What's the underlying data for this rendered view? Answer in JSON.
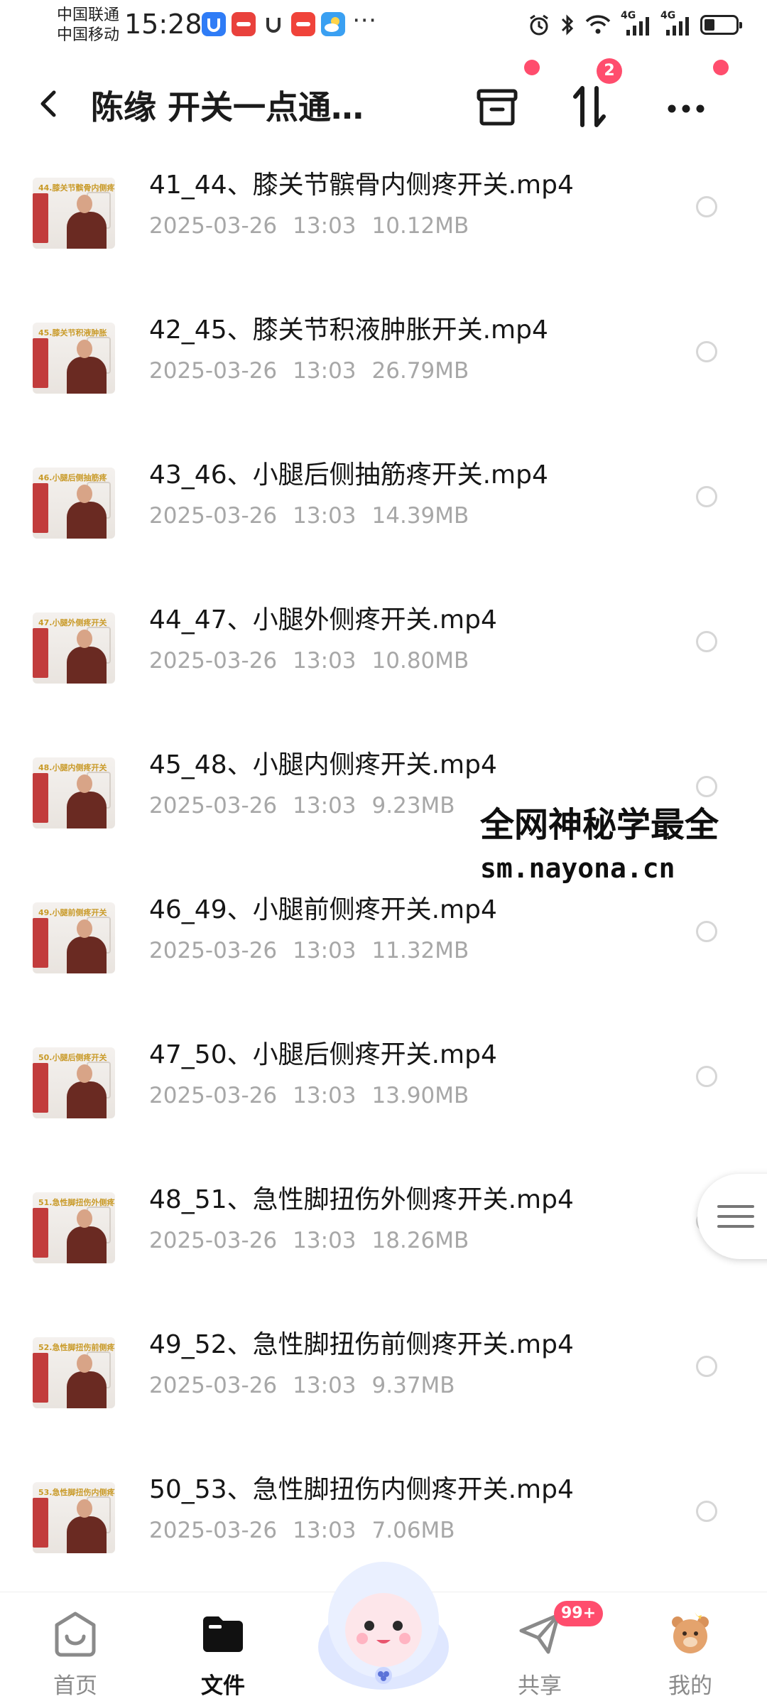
{
  "status_bar": {
    "carrier_1": "中国联通",
    "carrier_2": "中国移动",
    "time": "15:28",
    "signal_label_1": "4G",
    "signal_label_2": "4G"
  },
  "app_bar": {
    "title": "陈缘 开关一点通…",
    "sort_badge": "2"
  },
  "files": [
    {
      "name": "41_44、膝关节髌骨内侧疼开关.mp4",
      "date": "2025-03-26",
      "time": "13:03",
      "size": "10.12MB",
      "thumb_title": "44.膝关节髌骨内侧疼"
    },
    {
      "name": "42_45、膝关节积液肿胀开关.mp4",
      "date": "2025-03-26",
      "time": "13:03",
      "size": "26.79MB",
      "thumb_title": "45.膝关节积液肿胀"
    },
    {
      "name": "43_46、小腿后侧抽筋疼开关.mp4",
      "date": "2025-03-26",
      "time": "13:03",
      "size": "14.39MB",
      "thumb_title": "46.小腿后侧抽筋疼"
    },
    {
      "name": "44_47、小腿外侧疼开关.mp4",
      "date": "2025-03-26",
      "time": "13:03",
      "size": "10.80MB",
      "thumb_title": "47.小腿外侧疼开关"
    },
    {
      "name": "45_48、小腿内侧疼开关.mp4",
      "date": "2025-03-26",
      "time": "13:03",
      "size": "9.23MB",
      "thumb_title": "48.小腿内侧疼开关"
    },
    {
      "name": "46_49、小腿前侧疼开关.mp4",
      "date": "2025-03-26",
      "time": "13:03",
      "size": "11.32MB",
      "thumb_title": "49.小腿前侧疼开关"
    },
    {
      "name": "47_50、小腿后侧疼开关.mp4",
      "date": "2025-03-26",
      "time": "13:03",
      "size": "13.90MB",
      "thumb_title": "50.小腿后侧疼开关"
    },
    {
      "name": "48_51、急性脚扭伤外侧疼开关.mp4",
      "date": "2025-03-26",
      "time": "13:03",
      "size": "18.26MB",
      "thumb_title": "51.急性脚扭伤外侧疼"
    },
    {
      "name": "49_52、急性脚扭伤前侧疼开关.mp4",
      "date": "2025-03-26",
      "time": "13:03",
      "size": "9.37MB",
      "thumb_title": "52.急性脚扭伤前侧疼"
    },
    {
      "name": "50_53、急性脚扭伤内侧疼开关.mp4",
      "date": "2025-03-26",
      "time": "13:03",
      "size": "7.06MB",
      "thumb_title": "53.急性脚扭伤内侧疼"
    }
  ],
  "watermark": {
    "line1": "全网神秘学最全",
    "line2": "sm.nayona.cn"
  },
  "bottom_nav": {
    "home": "首页",
    "files": "文件",
    "share": "共享",
    "share_badge": "99+",
    "mine": "我的"
  },
  "colors": {
    "accent_red": "#ff4d6d",
    "meta_gray": "#a7a7a7",
    "active_black": "#111111"
  }
}
